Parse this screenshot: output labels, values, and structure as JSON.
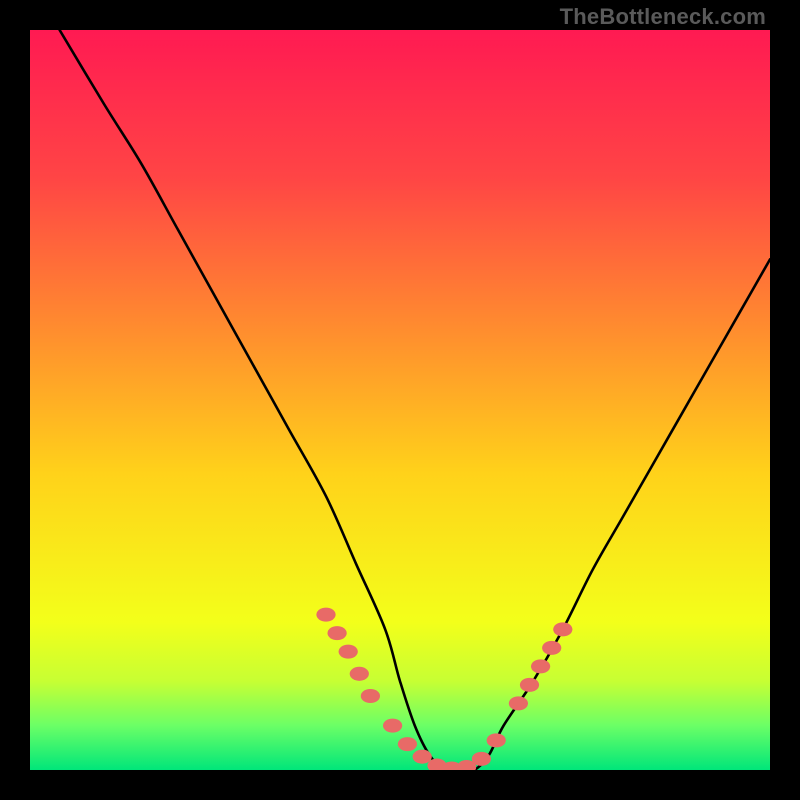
{
  "watermark": "TheBottleneck.com",
  "colors": {
    "page_bg": "#000000",
    "curve": "#000000",
    "dot_fill": "#e86a67",
    "gradient_stops": [
      {
        "offset": 0.0,
        "color": "#ff1a52"
      },
      {
        "offset": 0.2,
        "color": "#ff4545"
      },
      {
        "offset": 0.4,
        "color": "#ff8b2f"
      },
      {
        "offset": 0.6,
        "color": "#ffd21a"
      },
      {
        "offset": 0.8,
        "color": "#f3ff1a"
      },
      {
        "offset": 0.88,
        "color": "#c7ff33"
      },
      {
        "offset": 0.94,
        "color": "#6bff66"
      },
      {
        "offset": 1.0,
        "color": "#00e67a"
      }
    ]
  },
  "chart_data": {
    "type": "line",
    "title": "",
    "xlabel": "",
    "ylabel": "",
    "xlim": [
      0,
      100
    ],
    "ylim": [
      0,
      100
    ],
    "grid": false,
    "legend": false,
    "series": [
      {
        "name": "bottleneck-curve",
        "x": [
          4,
          10,
          15,
          20,
          25,
          30,
          35,
          40,
          44,
          48,
          50,
          52,
          54,
          56,
          58,
          60,
          62,
          64,
          68,
          72,
          76,
          80,
          84,
          88,
          92,
          96,
          100
        ],
        "y": [
          100,
          90,
          82,
          73,
          64,
          55,
          46,
          37,
          28,
          19,
          12,
          6,
          2,
          0,
          0,
          0,
          2,
          6,
          12,
          19,
          27,
          34,
          41,
          48,
          55,
          62,
          69
        ]
      }
    ],
    "highlight_dots": {
      "name": "bottleneck-dots",
      "x": [
        40,
        41.5,
        43,
        44.5,
        46,
        49,
        51,
        53,
        55,
        57,
        59,
        61,
        63,
        66,
        67.5,
        69,
        70.5,
        72
      ],
      "y": [
        21,
        18.5,
        16,
        13,
        10,
        6,
        3.5,
        1.8,
        0.6,
        0.2,
        0.4,
        1.5,
        4,
        9,
        11.5,
        14,
        16.5,
        19
      ]
    }
  }
}
